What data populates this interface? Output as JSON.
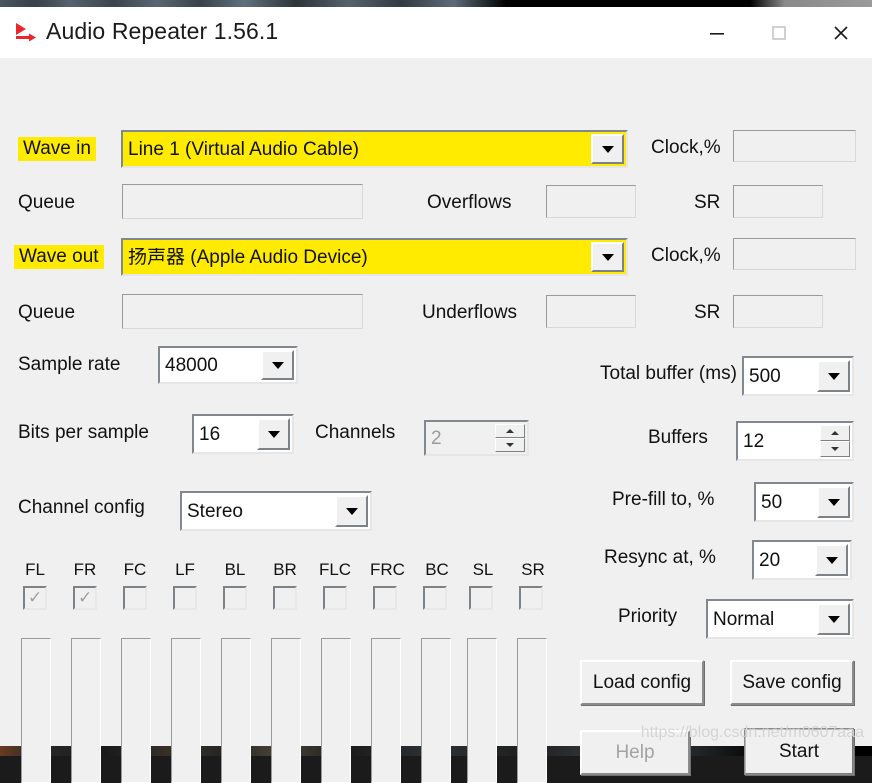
{
  "window": {
    "title": "Audio Repeater 1.56.1",
    "icon": "audio-repeater-icon",
    "controls": {
      "minimize": "minimize-icon",
      "maximize": "maximize-icon",
      "close": "close-icon"
    }
  },
  "input_section": {
    "wave_in_label": "Wave in",
    "wave_in_value": "Line 1 (Virtual Audio Cable)",
    "queue_label": "Queue",
    "queue_value": "",
    "overflows_label": "Overflows",
    "overflows_value": "",
    "clock_label": "Clock,%",
    "clock_value": "",
    "sr_label": "SR",
    "sr_value": ""
  },
  "output_section": {
    "wave_out_label": "Wave out",
    "wave_out_value": "扬声器 (Apple Audio Device)",
    "queue_label": "Queue",
    "queue_value": "",
    "underflows_label": "Underflows",
    "underflows_value": "",
    "clock_label": "Clock,%",
    "clock_value": "",
    "sr_label": "SR",
    "sr_value": ""
  },
  "format": {
    "sample_rate_label": "Sample rate",
    "sample_rate_value": "48000",
    "bits_label": "Bits per sample",
    "bits_value": "16",
    "channels_label": "Channels",
    "channels_value": "2",
    "channel_config_label": "Channel config",
    "channel_config_value": "Stereo"
  },
  "channels": [
    {
      "label": "FL",
      "checked": true,
      "disabled": true
    },
    {
      "label": "FR",
      "checked": true,
      "disabled": true
    },
    {
      "label": "FC",
      "checked": false,
      "disabled": false
    },
    {
      "label": "LF",
      "checked": false,
      "disabled": false
    },
    {
      "label": "BL",
      "checked": false,
      "disabled": false
    },
    {
      "label": "BR",
      "checked": false,
      "disabled": false
    },
    {
      "label": "FLC",
      "checked": false,
      "disabled": false
    },
    {
      "label": "FRC",
      "checked": false,
      "disabled": false
    },
    {
      "label": "BC",
      "checked": false,
      "disabled": false
    },
    {
      "label": "SL",
      "checked": false,
      "disabled": false
    },
    {
      "label": "SR",
      "checked": false,
      "disabled": false
    }
  ],
  "meters": [
    0,
    0,
    0,
    0,
    0,
    0,
    0,
    0,
    0,
    0,
    0
  ],
  "buffering": {
    "total_buffer_label": "Total buffer (ms)",
    "total_buffer_value": "500",
    "buffers_label": "Buffers",
    "buffers_value": "12",
    "prefill_label": "Pre-fill to, %",
    "prefill_value": "50",
    "resync_label": "Resync at, %",
    "resync_value": "20",
    "priority_label": "Priority",
    "priority_value": "Normal"
  },
  "actions": {
    "load_config": "Load config",
    "save_config": "Save config",
    "help": "Help",
    "start": "Start"
  },
  "watermark": "https://blog.csdn.net/m0607aaa",
  "colors": {
    "highlight": "#ffeb00",
    "window_bg": "#f0f0f0",
    "titlebar_bg": "#ffffff",
    "icon_red": "#e8262b"
  }
}
